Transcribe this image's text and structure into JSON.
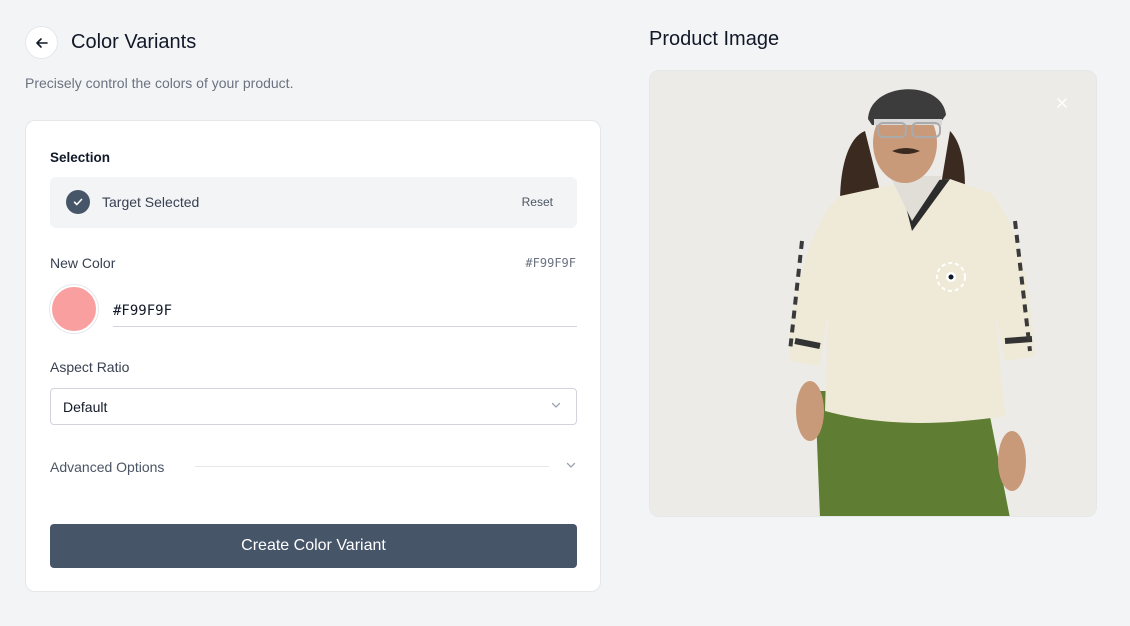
{
  "header": {
    "title": "Color Variants",
    "subtitle": "Precisely control the colors of your product."
  },
  "selection": {
    "label": "Selection",
    "status": "Target Selected",
    "reset_label": "Reset"
  },
  "color": {
    "label": "New Color",
    "hex": "#F99F9F",
    "swatch_color": "#F99F9F"
  },
  "aspect": {
    "label": "Aspect Ratio",
    "value": "Default"
  },
  "advanced": {
    "label": "Advanced Options"
  },
  "actions": {
    "create_label": "Create Color Variant"
  },
  "preview": {
    "title": "Product Image"
  },
  "colors": {
    "primary": "#475569",
    "background": "#f3f4f6"
  }
}
